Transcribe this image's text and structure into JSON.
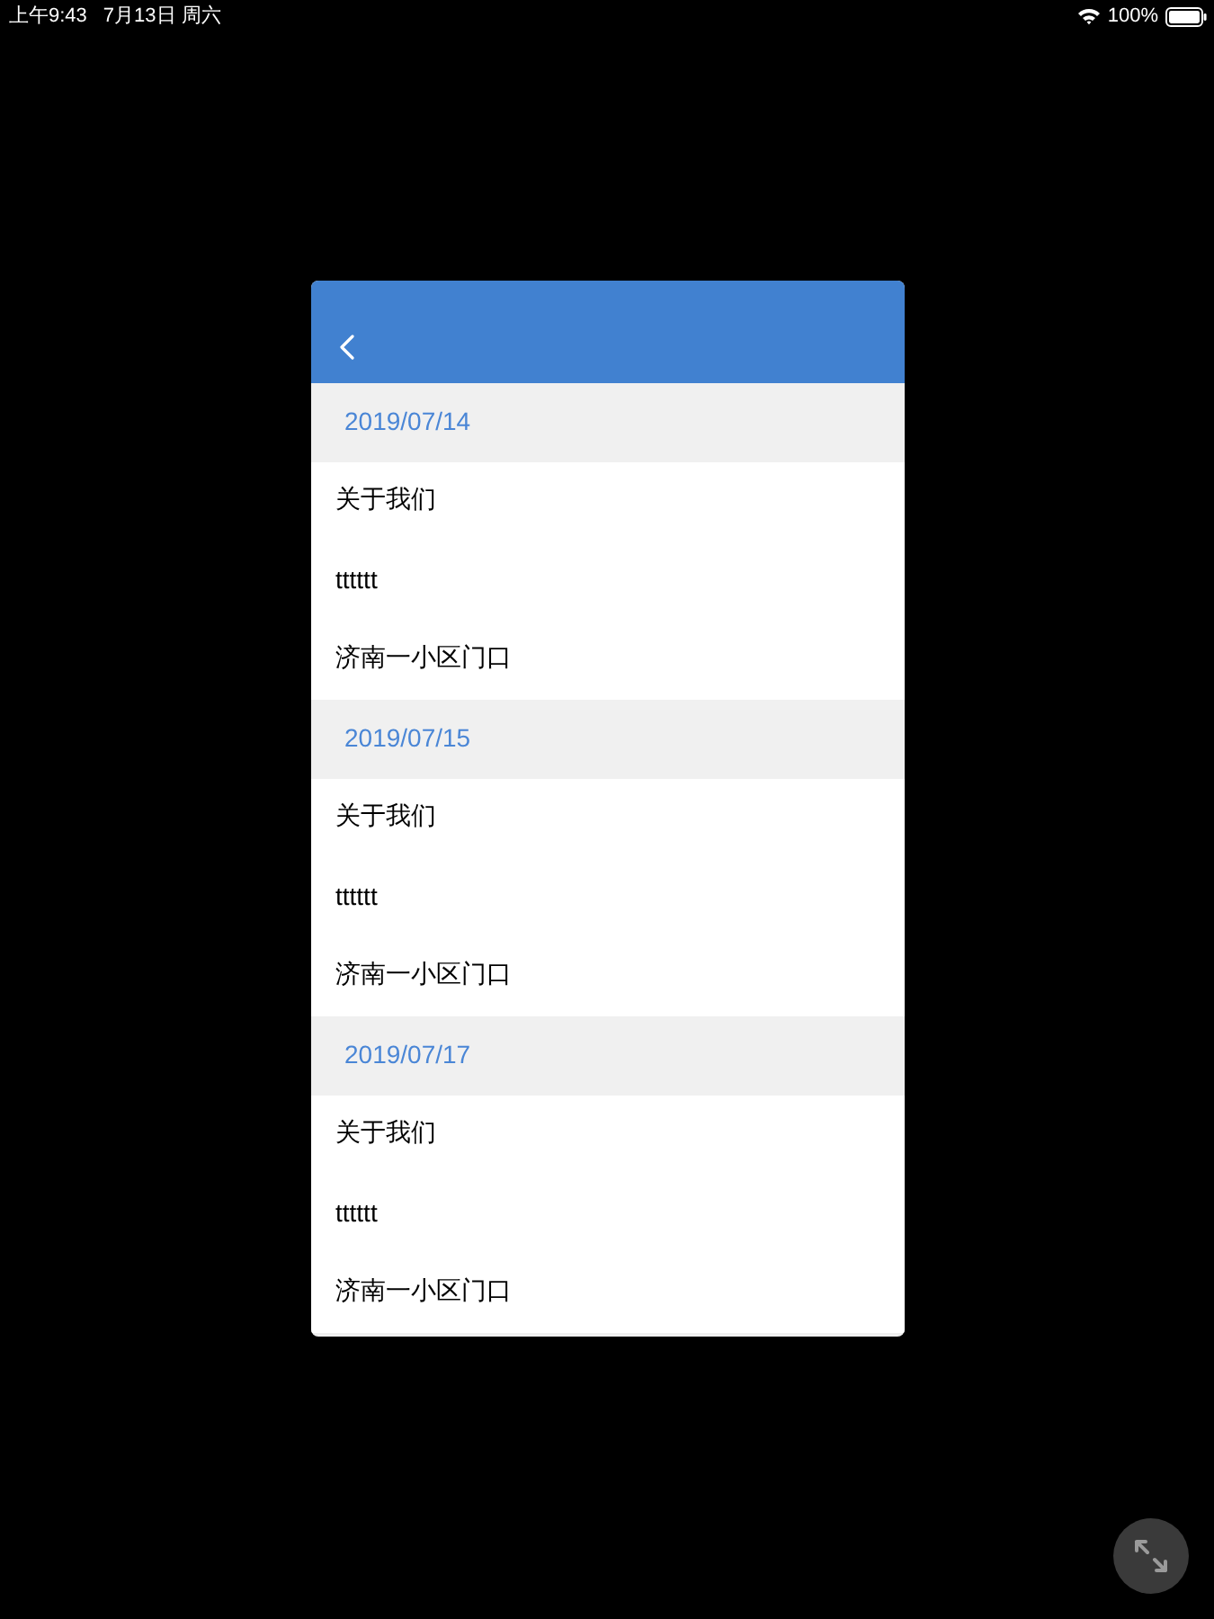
{
  "status_bar": {
    "time": "上午9:43",
    "date": "7月13日 周六",
    "battery": "100%"
  },
  "sections": [
    {
      "date": "2019/07/14",
      "items": [
        "关于我们",
        "tttttt",
        "济南一小区门口"
      ]
    },
    {
      "date": "2019/07/15",
      "items": [
        "关于我们",
        "tttttt",
        "济南一小区门口"
      ]
    },
    {
      "date": "2019/07/17",
      "items": [
        "关于我们",
        "tttttt",
        "济南一小区门口"
      ]
    }
  ]
}
